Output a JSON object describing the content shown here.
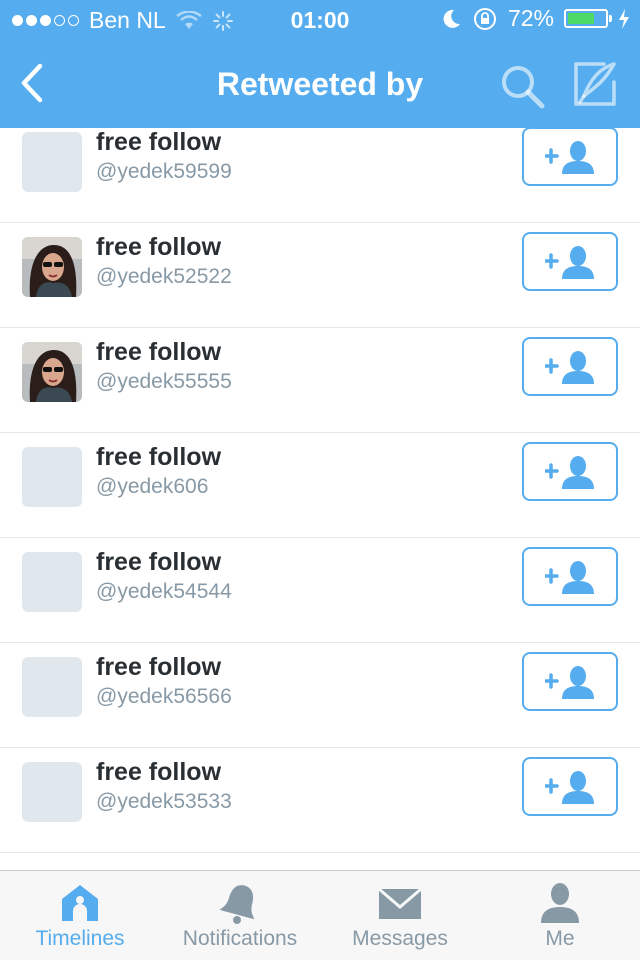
{
  "status_bar": {
    "carrier": "Ben NL",
    "time": "01:00",
    "battery_percent": "72%",
    "battery_level": 0.72
  },
  "nav": {
    "title": "Retweeted by"
  },
  "users": [
    {
      "name": "free follow",
      "handle": "@yedek59599",
      "avatar": "placeholder"
    },
    {
      "name": "free follow",
      "handle": "@yedek52522",
      "avatar": "photo"
    },
    {
      "name": "free follow",
      "handle": "@yedek55555",
      "avatar": "photo"
    },
    {
      "name": "free follow",
      "handle": "@yedek606",
      "avatar": "placeholder"
    },
    {
      "name": "free follow",
      "handle": "@yedek54544",
      "avatar": "placeholder"
    },
    {
      "name": "free follow",
      "handle": "@yedek56566",
      "avatar": "placeholder"
    },
    {
      "name": "free follow",
      "handle": "@yedek53533",
      "avatar": "placeholder"
    }
  ],
  "tabs": [
    {
      "label": "Timelines",
      "icon": "home-icon",
      "active": true
    },
    {
      "label": "Notifications",
      "icon": "bell-icon",
      "active": false
    },
    {
      "label": "Messages",
      "icon": "envelope-icon",
      "active": false
    },
    {
      "label": "Me",
      "icon": "person-icon",
      "active": false
    }
  ],
  "colors": {
    "accent": "#55acee",
    "text": "#292f33",
    "secondary_text": "#8899a6",
    "divider": "#e1e8ed",
    "battery": "#4cd964"
  }
}
